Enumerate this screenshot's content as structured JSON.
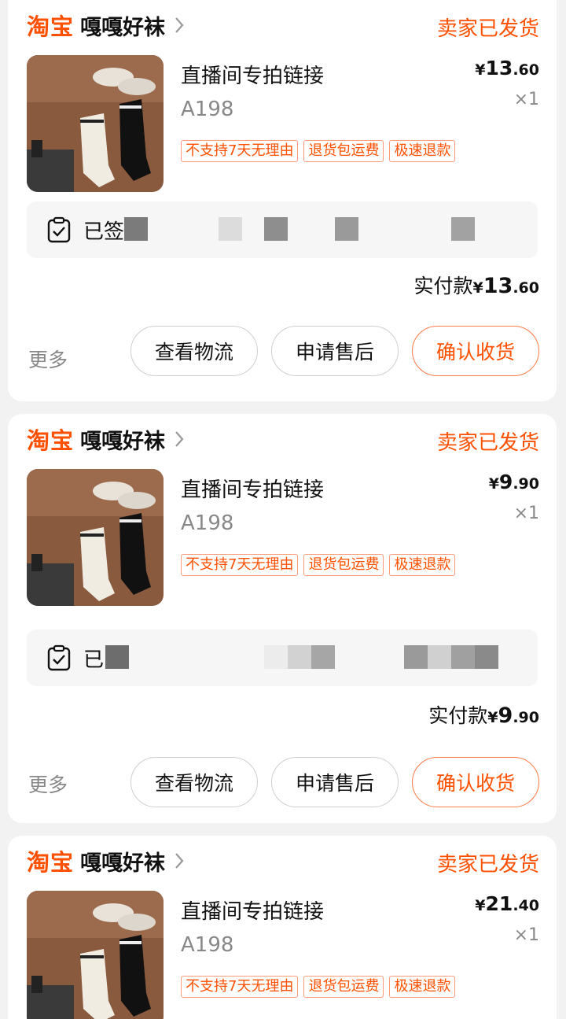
{
  "orders": [
    {
      "platform": "淘宝",
      "shop_name": "嘎嘎好袜",
      "status": "卖家已发货",
      "product_title": "直播间专拍链接",
      "sku": "A198",
      "tags": [
        "不支持7天无理由",
        "退货包运费",
        "极速退款"
      ],
      "price": {
        "yen": "¥",
        "int": "13",
        "dec": ".60"
      },
      "quantity": "×1",
      "logistics_text": "已签",
      "paid_label": "实付款",
      "paid": {
        "yen": "¥",
        "int": "13",
        "dec": ".60"
      },
      "more_label": "更多",
      "buttons": {
        "logistics": "查看物流",
        "after_sale": "申请售后",
        "confirm": "确认收货"
      }
    },
    {
      "platform": "淘宝",
      "shop_name": "嘎嘎好袜",
      "status": "卖家已发货",
      "product_title": "直播间专拍链接",
      "sku": "A198",
      "tags": [
        "不支持7天无理由",
        "退货包运费",
        "极速退款"
      ],
      "price": {
        "yen": "¥",
        "int": "9",
        "dec": ".90"
      },
      "quantity": "×1",
      "logistics_text": "已",
      "paid_label": "实付款",
      "paid": {
        "yen": "¥",
        "int": "9",
        "dec": ".90"
      },
      "more_label": "更多",
      "buttons": {
        "logistics": "查看物流",
        "after_sale": "申请售后",
        "confirm": "确认收货"
      }
    },
    {
      "platform": "淘宝",
      "shop_name": "嘎嘎好袜",
      "status": "卖家已发货",
      "product_title": "直播间专拍链接",
      "sku": "A198",
      "tags": [
        "不支持7天无理由",
        "退货包运费",
        "极速退款"
      ],
      "price": {
        "yen": "¥",
        "int": "21",
        "dec": ".40"
      },
      "quantity": "×1"
    }
  ],
  "colors": {
    "accent": "#ff5000",
    "background": "#f2f2f2",
    "card": "#ffffff"
  }
}
